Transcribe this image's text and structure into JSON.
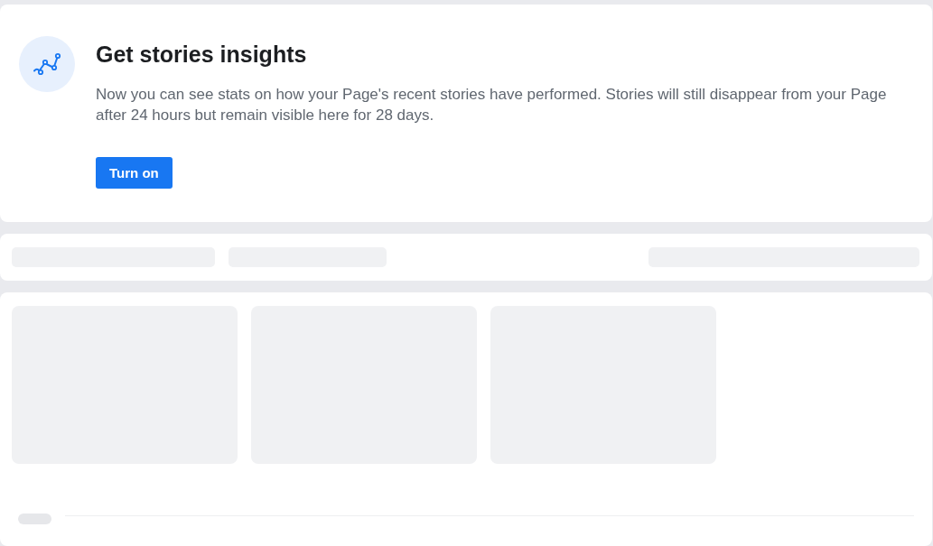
{
  "insights_card": {
    "title": "Get stories insights",
    "description": "Now you can see stats on how your Page's recent stories have performed. Stories will still disappear from your Page after 24 hours but remain visible here for 28 days.",
    "button": "Turn on"
  },
  "filter_bar": {
    "loading": true
  },
  "stories_panel": {
    "loading": true
  }
}
